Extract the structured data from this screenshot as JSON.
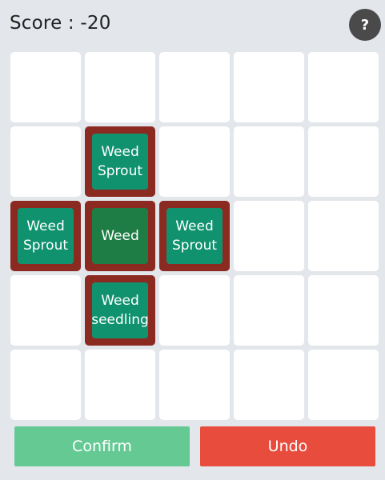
{
  "score": {
    "label": "Score",
    "separator": " : ",
    "value": "-20"
  },
  "help": {
    "label": "?"
  },
  "board": {
    "rows": 5,
    "cols": 5,
    "cells": [
      {
        "row": 1,
        "col": 1,
        "label": "Weed Sprout",
        "kind": "sprout"
      },
      {
        "row": 2,
        "col": 0,
        "label": "Weed Sprout",
        "kind": "sprout"
      },
      {
        "row": 2,
        "col": 1,
        "label": "Weed",
        "kind": "weed"
      },
      {
        "row": 2,
        "col": 2,
        "label": "Weed Sprout",
        "kind": "sprout"
      },
      {
        "row": 3,
        "col": 1,
        "label": "Weed seedling",
        "kind": "seedling"
      }
    ]
  },
  "buttons": {
    "confirm": "Confirm",
    "undo": "Undo"
  },
  "colors": {
    "background": "#e3e7ec",
    "weed_border": "#8b2a21",
    "tile_green": "#11926f",
    "weed_dark": "#1e7d44",
    "confirm": "#65c994",
    "undo": "#e74c3c"
  }
}
